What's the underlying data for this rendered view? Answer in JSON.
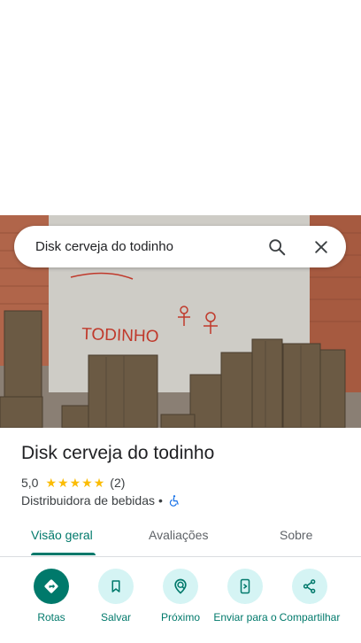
{
  "search": {
    "query": "Disk cerveja do todinho"
  },
  "place": {
    "title": "Disk cerveja do todinho",
    "rating_value": "5,0",
    "rating_stars": 5,
    "review_count": "(2)",
    "category": "Distribuidora de bebidas",
    "separator": "•"
  },
  "photo": {
    "wall_text": "TODINHO"
  },
  "tabs": [
    {
      "label": "Visão geral",
      "active": true
    },
    {
      "label": "Avaliações",
      "active": false
    },
    {
      "label": "Sobre",
      "active": false
    }
  ],
  "actions": [
    {
      "label": "Rotas",
      "icon": "directions-icon"
    },
    {
      "label": "Salvar",
      "icon": "bookmark-icon"
    },
    {
      "label": "Próximo",
      "icon": "nearby-icon"
    },
    {
      "label": "Enviar para o",
      "icon": "send-to-phone-icon"
    },
    {
      "label": "Compartilhar",
      "icon": "share-icon"
    }
  ],
  "colors": {
    "accent": "#00796b",
    "button_bg": "#d5f4f4",
    "star": "#fbbc04",
    "accessibility": "#1a73e8"
  }
}
